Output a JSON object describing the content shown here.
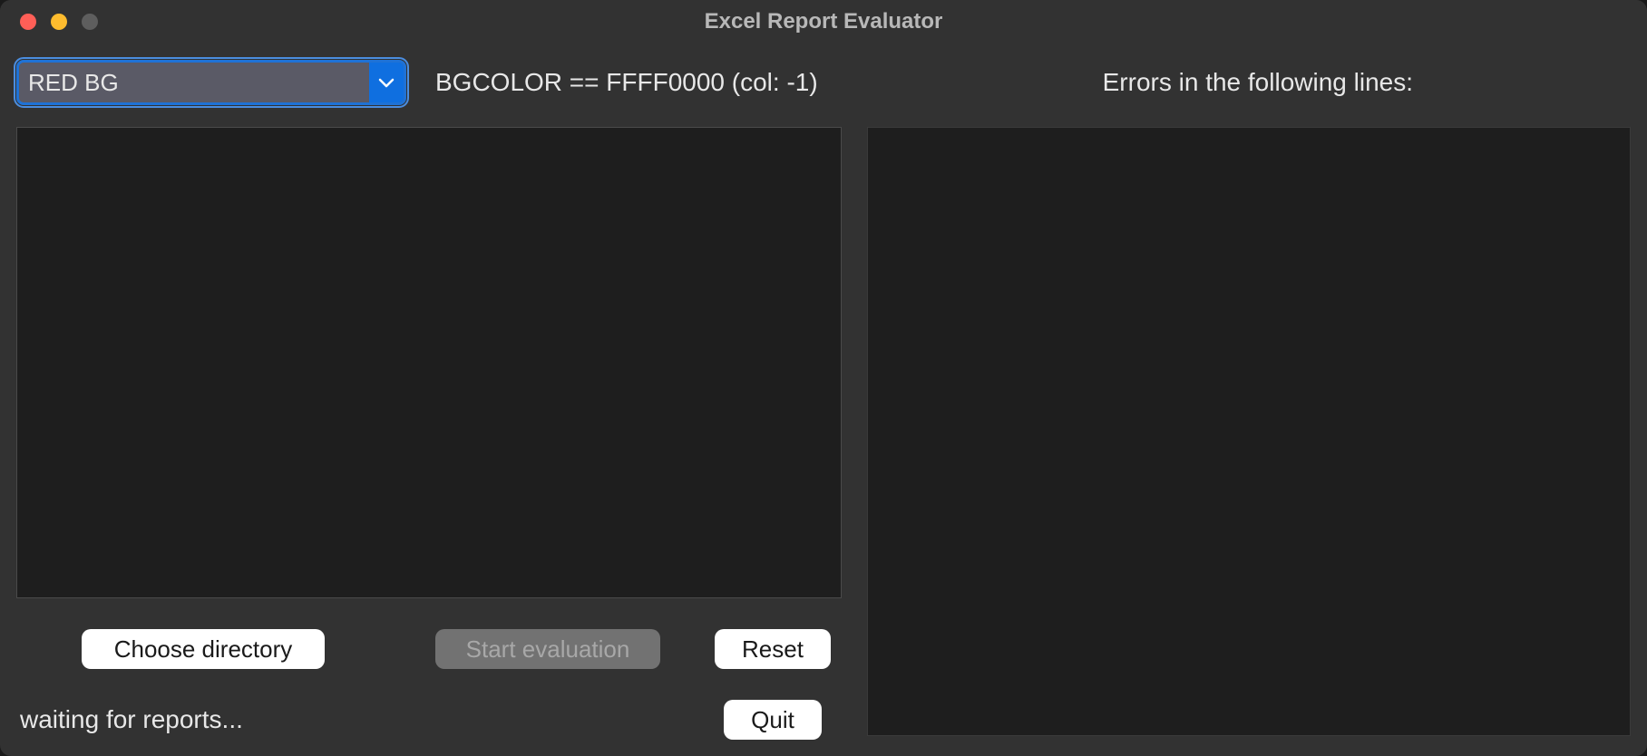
{
  "window": {
    "title": "Excel Report Evaluator"
  },
  "toolbar": {
    "combo_selected": "RED BG",
    "info_text": "BGCOLOR == FFFF0000 (col: -1)",
    "errors_header": "Errors in the following lines:"
  },
  "buttons": {
    "choose_directory": "Choose directory",
    "start_evaluation": "Start evaluation",
    "reset": "Reset",
    "quit": "Quit"
  },
  "status": {
    "text": "waiting for reports..."
  }
}
